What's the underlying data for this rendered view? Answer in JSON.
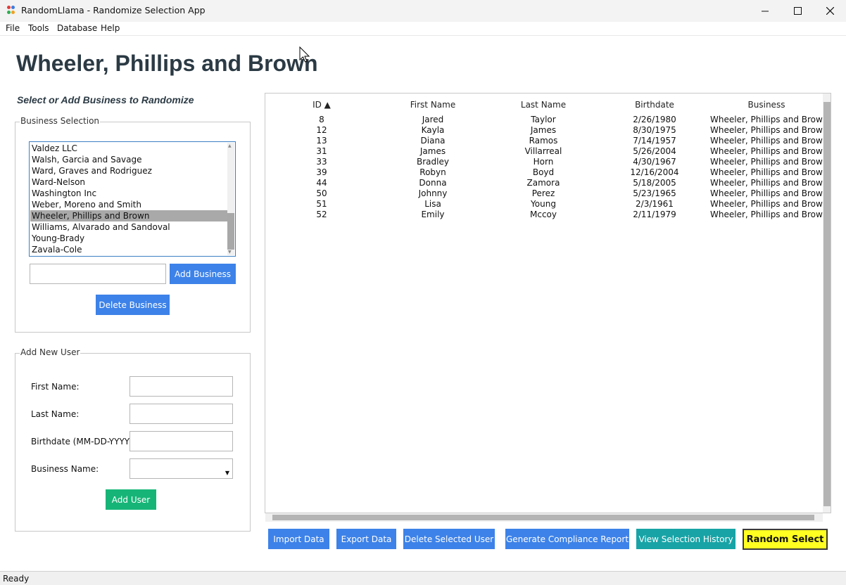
{
  "window": {
    "title": "RandomLlama - Randomize Selection App"
  },
  "menu": [
    "File",
    "Tools",
    "Database",
    "Help"
  ],
  "page_title": "Wheeler, Phillips and Brown",
  "business_section": {
    "subtitle": "Select or Add Business to Randomize",
    "group_label": "Business Selection",
    "list_items": [
      "Valdez LLC",
      "Walsh, Garcia and Savage",
      "Ward, Graves and Rodriguez",
      "Ward-Nelson",
      "Washington Inc",
      "Weber, Moreno and Smith",
      "Wheeler, Phillips and Brown",
      "Williams, Alvarado and Sandoval",
      "Young-Brady",
      "Zavala-Cole"
    ],
    "selected_item": "Wheeler, Phillips and Brown",
    "new_business_value": "",
    "add_label": "Add Business",
    "delete_label": "Delete Business"
  },
  "user_section": {
    "group_label": "Add New User",
    "first_name_label": "First Name:",
    "last_name_label": "Last Name:",
    "birthdate_label": "Birthdate (MM-DD-YYYY):",
    "business_name_label": "Business Name:",
    "first_name_value": "",
    "last_name_value": "",
    "birthdate_value": "",
    "business_name_value": "",
    "add_label": "Add User"
  },
  "table": {
    "columns": [
      "ID ▲",
      "First Name",
      "Last Name",
      "Birthdate",
      "Business"
    ],
    "rows": [
      [
        "8",
        "Jared",
        "Taylor",
        "2/26/1980",
        "Wheeler, Phillips and Brown"
      ],
      [
        "12",
        "Kayla",
        "James",
        "8/30/1975",
        "Wheeler, Phillips and Brown"
      ],
      [
        "13",
        "Diana",
        "Ramos",
        "7/14/1957",
        "Wheeler, Phillips and Brown"
      ],
      [
        "31",
        "James",
        "Villarreal",
        "5/26/2004",
        "Wheeler, Phillips and Brown"
      ],
      [
        "33",
        "Bradley",
        "Horn",
        "4/30/1967",
        "Wheeler, Phillips and Brown"
      ],
      [
        "39",
        "Robyn",
        "Boyd",
        "12/16/2004",
        "Wheeler, Phillips and Brown"
      ],
      [
        "44",
        "Donna",
        "Zamora",
        "5/18/2005",
        "Wheeler, Phillips and Brown"
      ],
      [
        "50",
        "Johnny",
        "Perez",
        "5/23/1965",
        "Wheeler, Phillips and Brown"
      ],
      [
        "51",
        "Lisa",
        "Young",
        "2/3/1961",
        "Wheeler, Phillips and Brown"
      ],
      [
        "52",
        "Emily",
        "Mccoy",
        "2/11/1979",
        "Wheeler, Phillips and Brown"
      ]
    ]
  },
  "actions": {
    "import": "Import Data",
    "export": "Export Data",
    "delete_user": "Delete Selected User",
    "compliance": "Generate Compliance Report",
    "history": "View Selection History",
    "random": "Random Select"
  },
  "status": "Ready",
  "colors": {
    "button_blue": "#3d82e8",
    "button_green": "#16b577",
    "button_teal": "#18a4a6",
    "random_yellow": "#ffff22",
    "title_color": "#2b3a44",
    "list_selection": "#a9a9a9"
  },
  "icons": {
    "app": "colored-dots-app-icon",
    "minimize": "minimize-icon",
    "maximize": "maximize-icon",
    "close": "close-icon",
    "dropdown": "chevron-down-icon",
    "cursor": "mouse-pointer-icon"
  }
}
